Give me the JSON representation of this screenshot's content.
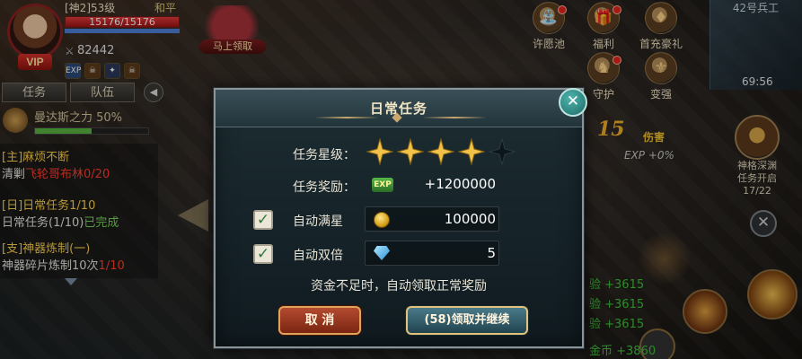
{
  "player": {
    "level_title": "[神2]53级",
    "server_mode": "和平",
    "hp_text": "15176/15176",
    "hp_fraction": 1.0,
    "power": "82442",
    "vip": "VIP",
    "exp_badge": "EXP"
  },
  "top_banner": {
    "claim_label": "马上领取"
  },
  "top_menu": [
    {
      "label": "许愿池",
      "icon": "wishing-pool-icon"
    },
    {
      "label": "福利",
      "icon": "welfare-icon"
    },
    {
      "label": "首充豪礼",
      "icon": "first-recharge-icon"
    },
    {
      "label": "守护",
      "icon": "guardian-icon"
    },
    {
      "label": "变强",
      "icon": "become-stronger-icon"
    }
  ],
  "map": {
    "label": "42号兵工",
    "time": "69:56"
  },
  "left_tabs": {
    "tasks": "任务",
    "team": "队伍"
  },
  "skill": {
    "name": "曼达斯之力 50%",
    "progress": 0.5
  },
  "quests": [
    {
      "line1": "[主]麻烦不断",
      "line2_a": "清剿",
      "line2_b": "飞轮哥布林0/20"
    },
    {
      "line1": "[日]日常任务1/10",
      "line2_a": "日常任务(1/10)",
      "line2_b": "已完成"
    },
    {
      "line1": "[支]神器炼制(一)",
      "line2_a": "神器碎片炼制10次",
      "line2_b": "1/10"
    }
  ],
  "dungeon": {
    "line1": "神格深渊",
    "line2": "任务开启",
    "count": "17/22"
  },
  "combat": {
    "number": "15",
    "exp_text": "EXP +0%",
    "side_text": "伤害"
  },
  "exp_log": [
    "验 +3615",
    "验 +3615",
    "验 +3615",
    "金币 +3860"
  ],
  "dialog": {
    "title": "日常任务",
    "star_label": "任务星级：",
    "stars_filled": 4,
    "stars_total": 5,
    "reward_label": "任务奖励：",
    "reward_icon": "EXP",
    "reward_value": "+1200000",
    "auto_star_label": "自动满星",
    "auto_star_checked": true,
    "auto_star_cost": "100000",
    "auto_double_label": "自动双倍",
    "auto_double_checked": true,
    "auto_double_cost": "5",
    "notice": "资金不足时，自动领取正常奖励",
    "cancel_label": "取 消",
    "confirm_label": "(58)领取并继续",
    "close_glyph": "✕"
  },
  "colors": {
    "accent_gold": "#f1c24a",
    "dialog_bg": "#1d2d32",
    "confirm_btn": "#4a7a8a",
    "cancel_btn": "#b34b2f"
  }
}
